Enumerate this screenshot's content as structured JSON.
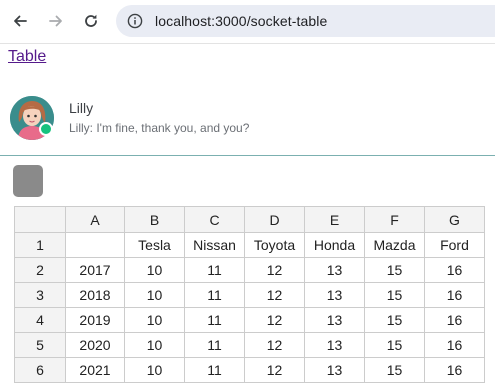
{
  "browser": {
    "url": "localhost:3000/socket-table"
  },
  "page": {
    "table_link": "Table"
  },
  "chat": {
    "name": "Lilly",
    "message": "Lilly: I'm fine, thank you, and you?"
  },
  "sheet": {
    "column_headers": [
      "",
      "A",
      "B",
      "C",
      "D",
      "E",
      "F",
      "G"
    ],
    "rows": [
      [
        "1",
        "",
        "Tesla",
        "Nissan",
        "Toyota",
        "Honda",
        "Mazda",
        "Ford"
      ],
      [
        "2",
        "2017",
        "10",
        "11",
        "12",
        "13",
        "15",
        "16"
      ],
      [
        "3",
        "2018",
        "10",
        "11",
        "12",
        "13",
        "15",
        "16"
      ],
      [
        "4",
        "2019",
        "10",
        "11",
        "12",
        "13",
        "15",
        "16"
      ],
      [
        "5",
        "2020",
        "10",
        "11",
        "12",
        "13",
        "15",
        "16"
      ],
      [
        "6",
        "2021",
        "10",
        "11",
        "12",
        "13",
        "15",
        "16"
      ]
    ]
  },
  "colors": {
    "link": "#551a8b",
    "online_status": "#17c27e",
    "divider": "#7bb0b0",
    "action_button": "#8a8a8a",
    "header_cell": "#f3f3f3"
  },
  "icons": [
    "back-arrow-icon",
    "forward-arrow-icon",
    "reload-icon",
    "info-icon",
    "avatar",
    "online-status-icon"
  ]
}
